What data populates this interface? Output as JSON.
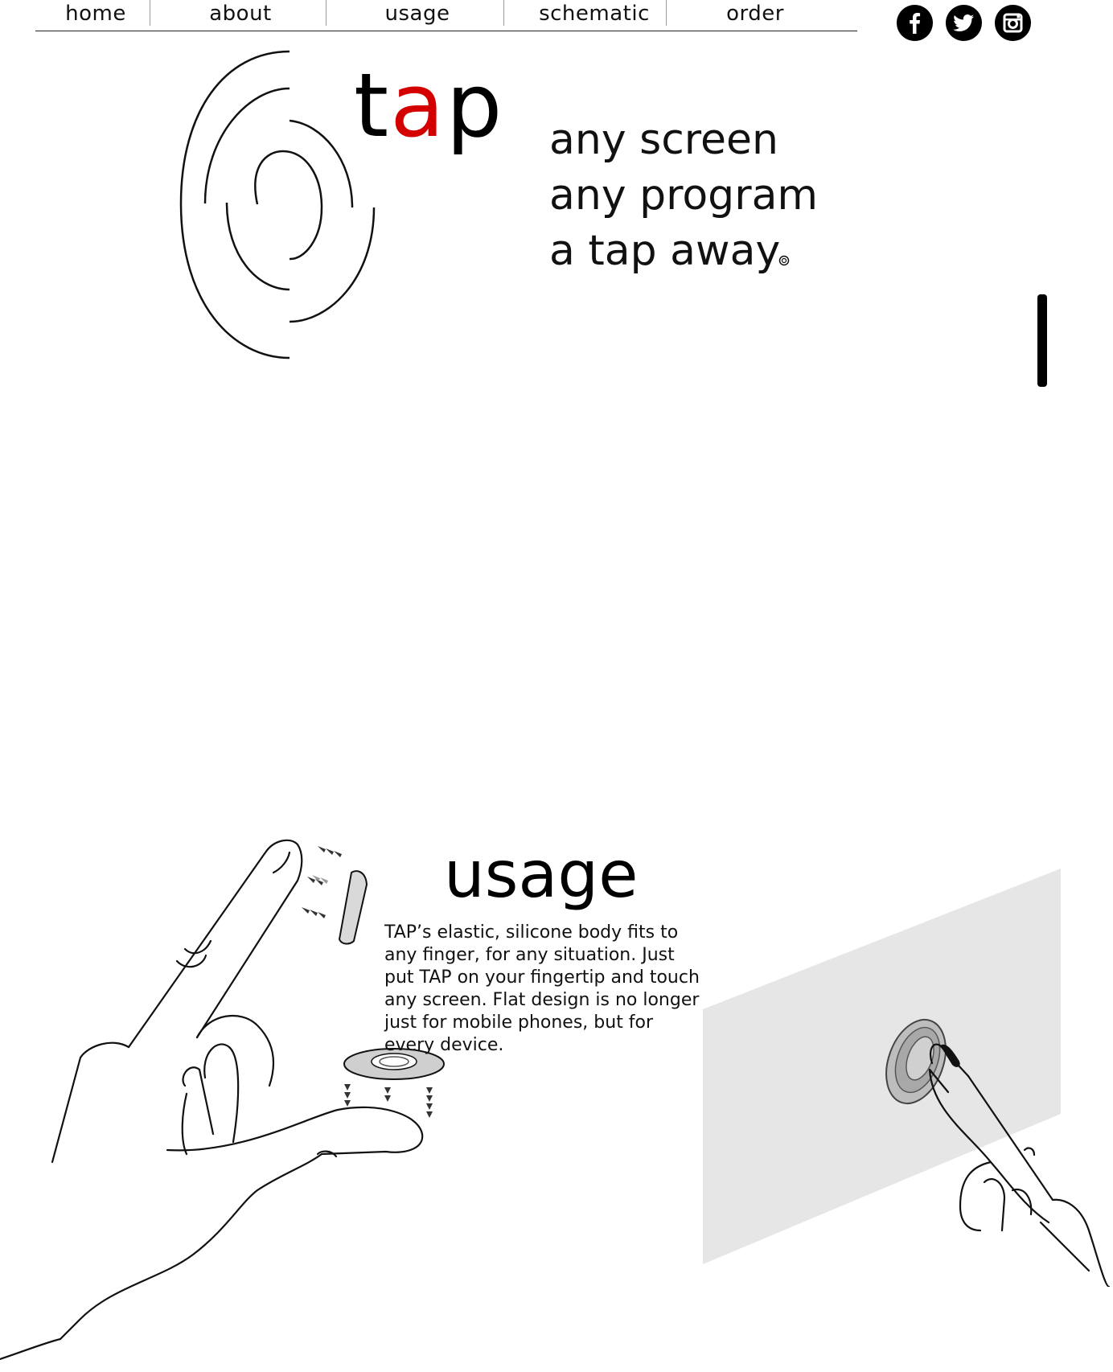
{
  "nav": {
    "items": [
      {
        "label": "home"
      },
      {
        "label": "about"
      },
      {
        "label": "usage"
      },
      {
        "label": "schematic"
      },
      {
        "label": "order"
      }
    ]
  },
  "social": [
    {
      "icon": "facebook-icon"
    },
    {
      "icon": "twitter-icon"
    },
    {
      "icon": "instagram-icon"
    }
  ],
  "hero": {
    "wordmark_pre": "t",
    "wordmark_highlight": "a",
    "wordmark_post": "p",
    "tagline": [
      "any screen",
      "any program",
      "a tap away"
    ]
  },
  "usage": {
    "title": "usage",
    "body": "TAP’s elastic, silicone body fits to any finger, for any situation. Just put TAP on your fingertip and touch any screen. Flat design is no longer just for mobile phones, but for every device."
  },
  "colors": {
    "accent": "#d40000",
    "text": "#000000",
    "screen_panel": "#e6e6e6"
  }
}
